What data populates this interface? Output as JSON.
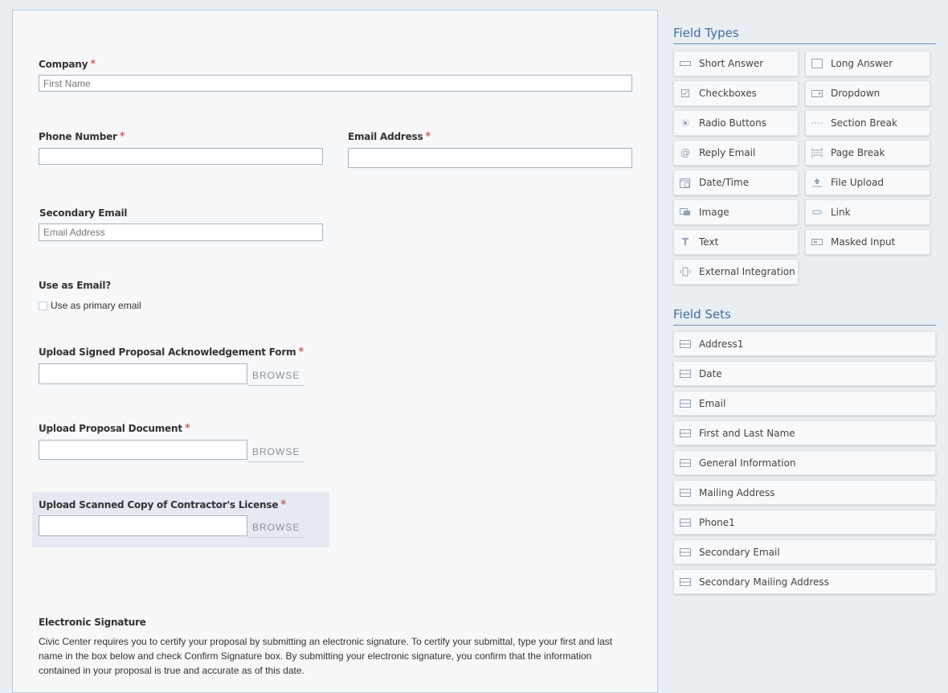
{
  "form": {
    "company": {
      "label": "Company",
      "placeholder": "First Name"
    },
    "phone": {
      "label": "Phone Number"
    },
    "email": {
      "label": "Email Address"
    },
    "secondary_email": {
      "label": "Secondary Email",
      "placeholder": "Email Address"
    },
    "use_as_email": {
      "label": "Use as Email?",
      "option": "Use as primary email"
    },
    "upload_ack": {
      "label": "Upload Signed Proposal Acknowledgement Form",
      "browse": "BROWSE"
    },
    "upload_doc": {
      "label": "Upload Proposal Document",
      "browse": "BROWSE"
    },
    "upload_license": {
      "label": "Upload Scanned Copy of Contractor's License",
      "browse": "BROWSE"
    },
    "signature": {
      "label": "Electronic Signature",
      "text": "Civic Center requires you to certify your proposal by submitting an electronic signature. To certify your submittal, type your first and last name in the box below and check Confirm Signature box. By submitting your electronic signature, you confirm that the information contained in your proposal is true and accurate as of this date."
    },
    "required_marker": "*"
  },
  "palette": {
    "field_types_title": "Field Types",
    "field_types": [
      {
        "label": "Short Answer",
        "icon": "short-answer-icon"
      },
      {
        "label": "Long Answer",
        "icon": "long-answer-icon"
      },
      {
        "label": "Checkboxes",
        "icon": "checkbox-icon"
      },
      {
        "label": "Dropdown",
        "icon": "dropdown-icon"
      },
      {
        "label": "Radio Buttons",
        "icon": "radio-icon"
      },
      {
        "label": "Section Break",
        "icon": "section-break-icon"
      },
      {
        "label": "Reply Email",
        "icon": "at-icon"
      },
      {
        "label": "Page Break",
        "icon": "page-break-icon"
      },
      {
        "label": "Date/Time",
        "icon": "calendar-icon"
      },
      {
        "label": "File Upload",
        "icon": "upload-icon"
      },
      {
        "label": "Image",
        "icon": "image-icon"
      },
      {
        "label": "Link",
        "icon": "link-icon"
      },
      {
        "label": "Text",
        "icon": "text-icon"
      },
      {
        "label": "Masked Input",
        "icon": "masked-input-icon"
      },
      {
        "label": "External Integration",
        "icon": "integration-icon"
      }
    ],
    "field_sets_title": "Field Sets",
    "field_sets": [
      {
        "label": "Address1"
      },
      {
        "label": "Date"
      },
      {
        "label": "Email"
      },
      {
        "label": "First and Last Name"
      },
      {
        "label": "General Information"
      },
      {
        "label": "Mailing Address"
      },
      {
        "label": "Phone1"
      },
      {
        "label": "Secondary Email"
      },
      {
        "label": "Secondary Mailing Address"
      }
    ]
  },
  "colors": {
    "accent": "#3d6fa3",
    "required": "#c0392b",
    "icon": "#8ea3b8"
  }
}
